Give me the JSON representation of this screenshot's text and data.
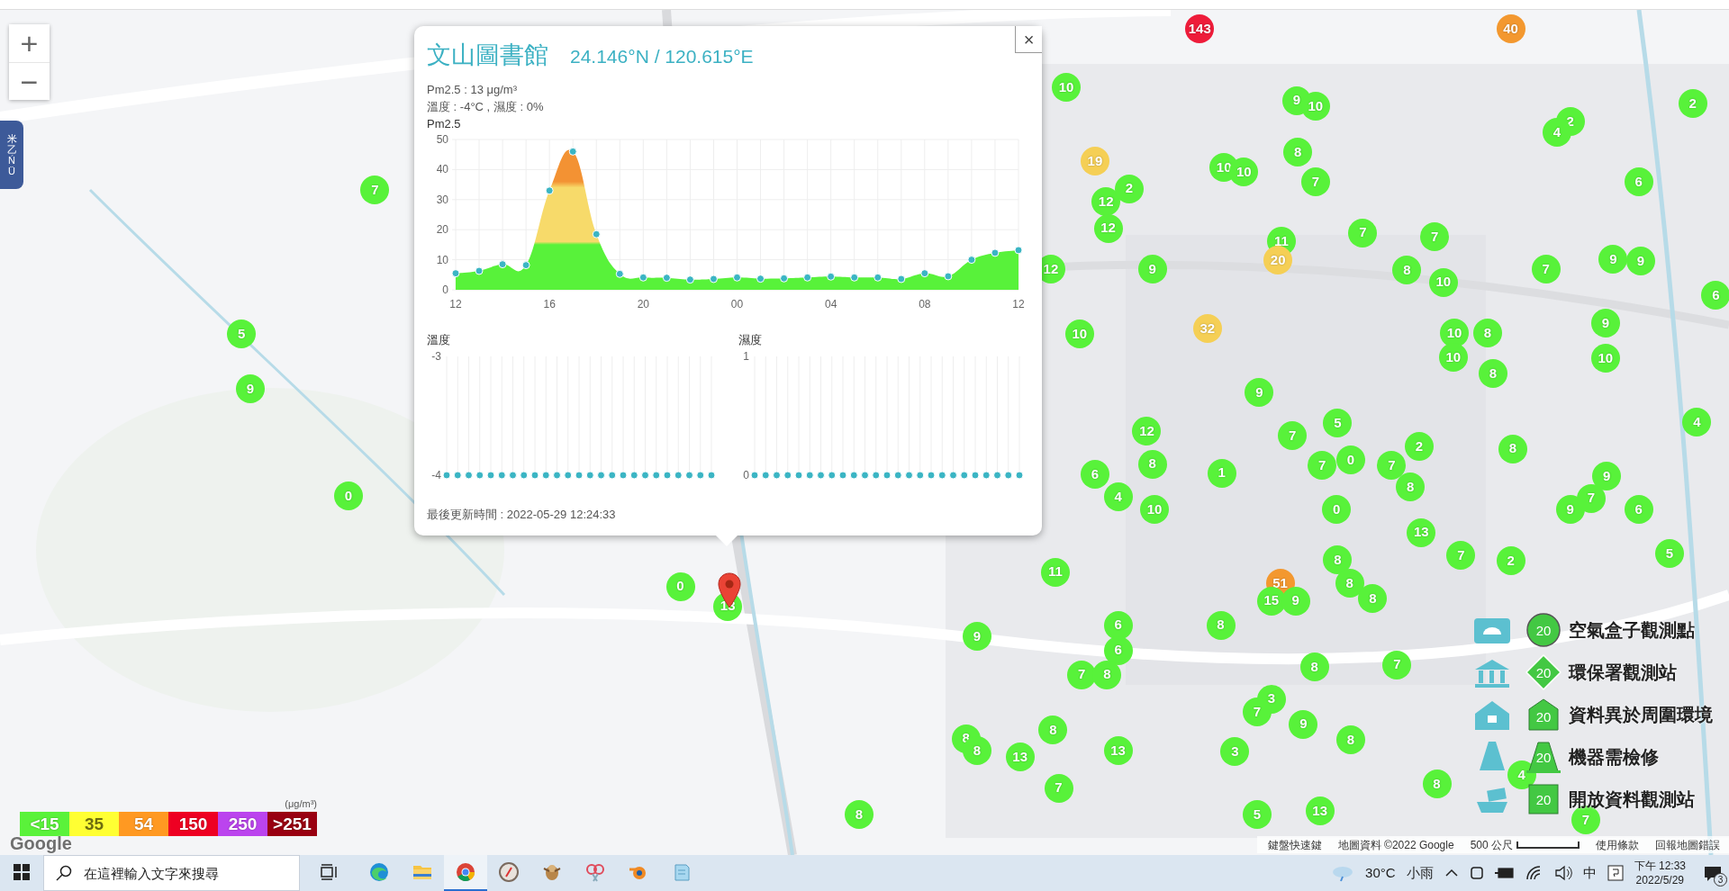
{
  "map": {
    "zoom_controls": [
      "+",
      "−"
    ],
    "side_tab": "米乙ŃÜ",
    "markers": [
      {
        "value": "143",
        "color": "#ee1c3a"
      },
      {
        "value": "40",
        "color": "#f3982f"
      },
      {
        "value": "10",
        "color": "#58f23a"
      },
      {
        "value": "9",
        "color": "#58f23a"
      },
      {
        "value": "10",
        "color": "#58f23a"
      },
      {
        "value": "2",
        "color": "#58f23a"
      },
      {
        "value": "2",
        "color": "#58f23a"
      },
      {
        "value": "4",
        "color": "#58f23a"
      },
      {
        "value": "8",
        "color": "#58f23a"
      },
      {
        "value": "10",
        "color": "#58f23a"
      },
      {
        "value": "10",
        "color": "#58f23a"
      },
      {
        "value": "19",
        "color": "#f5cf55"
      },
      {
        "value": "7",
        "color": "#58f23a"
      },
      {
        "value": "6",
        "color": "#58f23a"
      },
      {
        "value": "7",
        "color": "#58f23a"
      },
      {
        "value": "12",
        "color": "#58f23a"
      },
      {
        "value": "2",
        "color": "#58f23a"
      },
      {
        "value": "12",
        "color": "#58f23a"
      },
      {
        "value": "7",
        "color": "#58f23a"
      },
      {
        "value": "7",
        "color": "#58f23a"
      },
      {
        "value": "11",
        "color": "#58f23a"
      },
      {
        "value": "20",
        "color": "#f5cf55"
      },
      {
        "value": "12",
        "color": "#58f23a"
      },
      {
        "value": "9",
        "color": "#58f23a"
      },
      {
        "value": "8",
        "color": "#58f23a"
      },
      {
        "value": "10",
        "color": "#58f23a"
      },
      {
        "value": "7",
        "color": "#58f23a"
      },
      {
        "value": "9",
        "color": "#58f23a"
      },
      {
        "value": "9",
        "color": "#58f23a"
      },
      {
        "value": "6",
        "color": "#58f23a"
      },
      {
        "value": "5",
        "color": "#58f23a"
      },
      {
        "value": "10",
        "color": "#58f23a"
      },
      {
        "value": "32",
        "color": "#f5cf55"
      },
      {
        "value": "9",
        "color": "#58f23a"
      },
      {
        "value": "10",
        "color": "#58f23a"
      },
      {
        "value": "8",
        "color": "#58f23a"
      },
      {
        "value": "10",
        "color": "#58f23a"
      },
      {
        "value": "10",
        "color": "#58f23a"
      },
      {
        "value": "8",
        "color": "#58f23a"
      },
      {
        "value": "9",
        "color": "#58f23a"
      },
      {
        "value": "9",
        "color": "#58f23a"
      },
      {
        "value": "12",
        "color": "#58f23a"
      },
      {
        "value": "5",
        "color": "#58f23a"
      },
      {
        "value": "7",
        "color": "#58f23a"
      },
      {
        "value": "8",
        "color": "#58f23a"
      },
      {
        "value": "2",
        "color": "#58f23a"
      },
      {
        "value": "4",
        "color": "#58f23a"
      },
      {
        "value": "8",
        "color": "#58f23a"
      },
      {
        "value": "0",
        "color": "#58f23a"
      },
      {
        "value": "7",
        "color": "#58f23a"
      },
      {
        "value": "7",
        "color": "#58f23a"
      },
      {
        "value": "6",
        "color": "#58f23a"
      },
      {
        "value": "1",
        "color": "#58f23a"
      },
      {
        "value": "8",
        "color": "#58f23a"
      },
      {
        "value": "9",
        "color": "#58f23a"
      },
      {
        "value": "0",
        "color": "#58f23a"
      },
      {
        "value": "4",
        "color": "#58f23a"
      },
      {
        "value": "10",
        "color": "#58f23a"
      },
      {
        "value": "0",
        "color": "#58f23a"
      },
      {
        "value": "9",
        "color": "#58f23a"
      },
      {
        "value": "7",
        "color": "#58f23a"
      },
      {
        "value": "6",
        "color": "#58f23a"
      },
      {
        "value": "13",
        "color": "#58f23a"
      },
      {
        "value": "7",
        "color": "#58f23a"
      },
      {
        "value": "2",
        "color": "#58f23a"
      },
      {
        "value": "5",
        "color": "#58f23a"
      },
      {
        "value": "11",
        "color": "#58f23a"
      },
      {
        "value": "8",
        "color": "#58f23a"
      },
      {
        "value": "8",
        "color": "#58f23a"
      },
      {
        "value": "8",
        "color": "#58f23a"
      },
      {
        "value": "51",
        "color": "#f3982f"
      },
      {
        "value": "15",
        "color": "#58f23a"
      },
      {
        "value": "9",
        "color": "#58f23a"
      },
      {
        "value": "0",
        "color": "#58f23a"
      },
      {
        "value": "13",
        "color": "#58f23a"
      },
      {
        "value": "6",
        "color": "#58f23a"
      },
      {
        "value": "8",
        "color": "#58f23a"
      },
      {
        "value": "6",
        "color": "#58f23a"
      },
      {
        "value": "9",
        "color": "#58f23a"
      },
      {
        "value": "7",
        "color": "#58f23a"
      },
      {
        "value": "8",
        "color": "#58f23a"
      },
      {
        "value": "8",
        "color": "#58f23a"
      },
      {
        "value": "7",
        "color": "#58f23a"
      },
      {
        "value": "3",
        "color": "#58f23a"
      },
      {
        "value": "7",
        "color": "#58f23a"
      },
      {
        "value": "8",
        "color": "#58f23a"
      },
      {
        "value": "9",
        "color": "#58f23a"
      },
      {
        "value": "8",
        "color": "#58f23a"
      },
      {
        "value": "8",
        "color": "#58f23a"
      },
      {
        "value": "8",
        "color": "#58f23a"
      },
      {
        "value": "13",
        "color": "#58f23a"
      },
      {
        "value": "13",
        "color": "#58f23a"
      },
      {
        "value": "3",
        "color": "#58f23a"
      },
      {
        "value": "7",
        "color": "#58f23a"
      },
      {
        "value": "8",
        "color": "#58f23a"
      },
      {
        "value": "4",
        "color": "#58f23a"
      },
      {
        "value": "5",
        "color": "#58f23a"
      },
      {
        "value": "13",
        "color": "#58f23a"
      },
      {
        "value": "7",
        "color": "#58f23a"
      },
      {
        "value": "8",
        "color": "#58f23a"
      }
    ]
  },
  "popup": {
    "close": "×",
    "title": "文山圖書館",
    "coords": "24.146°N / 120.615°E",
    "lines": [
      "Pm2.5 : 13 μg/m³",
      "溫度 : -4°C , 濕度 : 0%"
    ],
    "pm_chart": {
      "chart_data": {
        "type": "area",
        "grid": true,
        "categories": [
          "12",
          null,
          null,
          null,
          "16",
          null,
          null,
          null,
          "20",
          null,
          null,
          null,
          "00",
          null,
          null,
          null,
          "04",
          null,
          null,
          null,
          "08",
          null,
          null,
          null,
          "12"
        ],
        "series": [
          {
            "name": "Pm2.5",
            "color": "#58f23a",
            "values": [
              5.5,
              6.3,
              8.5,
              8.2,
              33,
              46,
              18.5,
              5.3,
              4.1,
              4.0,
              3.4,
              3.6,
              4.1,
              3.7,
              3.8,
              4.1,
              4.4,
              4.1,
              4.1,
              3.6,
              5.5,
              4.5,
              10,
              12.3,
              13.2
            ]
          }
        ],
        "ylim": [
          0,
          50
        ],
        "yticks": [
          0,
          10,
          20,
          30,
          40,
          50
        ]
      }
    },
    "temp_chart": {
      "title": "溫度",
      "axis_labels": [
        "-3",
        "-4"
      ]
    },
    "humidity_chart": {
      "title": "濕度",
      "axis_labels": [
        "1",
        "0"
      ]
    },
    "updated": "最後更新時間 : 2022-05-29 12:24:33"
  },
  "pm_legend": {
    "unit": "(μg/m³)",
    "items": [
      {
        "label": "<15",
        "color": "#5af23a"
      },
      {
        "label": "35",
        "color": "#ffff33"
      },
      {
        "label": "54",
        "color": "#ff9922"
      },
      {
        "label": "150",
        "color": "#ee0022"
      },
      {
        "label": "250",
        "color": "#bb44ee"
      },
      {
        "label": ">251",
        "color": "#990011"
      }
    ]
  },
  "station_legend": [
    {
      "kind": "circle",
      "value": "20",
      "label": "空氣盒子觀測點"
    },
    {
      "kind": "diamond",
      "value": "20",
      "label": "環保署觀測站"
    },
    {
      "kind": "house",
      "value": "20",
      "label": "資料異於周圍環境"
    },
    {
      "kind": "cone",
      "value": "20",
      "label": "機器需檢修"
    },
    {
      "kind": "square",
      "value": "20",
      "label": "開放資料觀測站"
    }
  ],
  "attribution": {
    "logo": "Google",
    "shortcuts": "鍵盤快速鍵",
    "data": "地圖資料 ©2022 Google",
    "scale": "500 公尺",
    "links": [
      "使用條款",
      "回報地圖錯誤"
    ]
  },
  "taskbar": {
    "search_placeholder": "在這裡輸入文字來搜尋",
    "apps": [
      {
        "selected": false
      },
      {
        "selected": false
      },
      {
        "selected": true
      },
      {
        "selected": false
      },
      {
        "selected": false
      },
      {
        "selected": false
      },
      {
        "selected": false
      },
      {
        "selected": false
      }
    ],
    "weather": "30°C",
    "weather_text": "小雨",
    "ime": "中",
    "time": "下午 12:33",
    "date": "2022/5/29",
    "notifications": "3"
  }
}
